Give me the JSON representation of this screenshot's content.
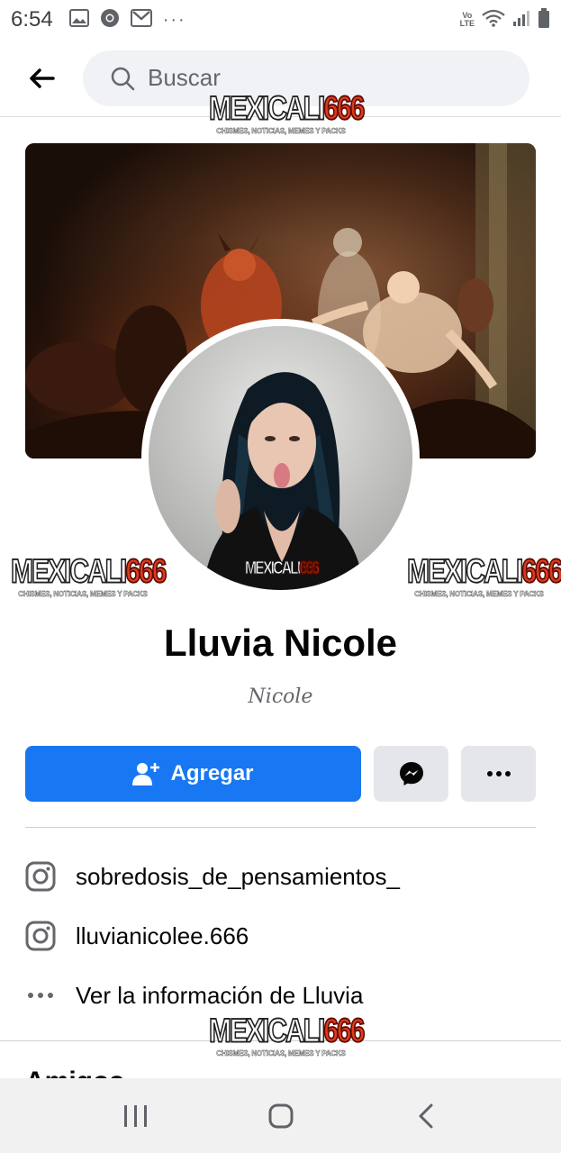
{
  "status_bar": {
    "time": "6:54",
    "overflow": "···",
    "volte": "Vo LTE",
    "left_icons": [
      "gallery-icon",
      "chrome-icon",
      "gmail-icon"
    ],
    "right_icons": [
      "wifi-icon",
      "signal-icon",
      "battery-icon"
    ]
  },
  "search": {
    "placeholder": "Buscar"
  },
  "watermark": {
    "title_text": "MEXICALI",
    "title_number": "666",
    "subtitle": "CHISMES, NOTICIAS, MEMES Y PACKS"
  },
  "profile": {
    "name": "Lluvia Nicole",
    "alternate_name": "Nicole"
  },
  "actions": {
    "add_label": "Agregar",
    "add_icon": "add-friend-icon",
    "messenger_icon": "messenger-icon",
    "more_icon": "more-icon"
  },
  "info": {
    "items": [
      {
        "icon": "instagram-icon",
        "text": "sobredosis_de_pensamientos_"
      },
      {
        "icon": "instagram-icon",
        "text": "lluvianicolee.666"
      },
      {
        "icon": "more-dots-icon",
        "text": "Ver la información de Lluvia"
      }
    ]
  },
  "friends_section": {
    "title": "Amigos"
  },
  "colors": {
    "primary": "#1877f2",
    "secondary_button": "#e4e6eb",
    "search_bg": "#f0f2f5",
    "text_primary": "#050505",
    "text_secondary": "#65676b",
    "watermark_red": "#e03a1e"
  },
  "nav": {
    "icons": [
      "recents-icon",
      "home-icon",
      "back-nav-icon"
    ]
  }
}
